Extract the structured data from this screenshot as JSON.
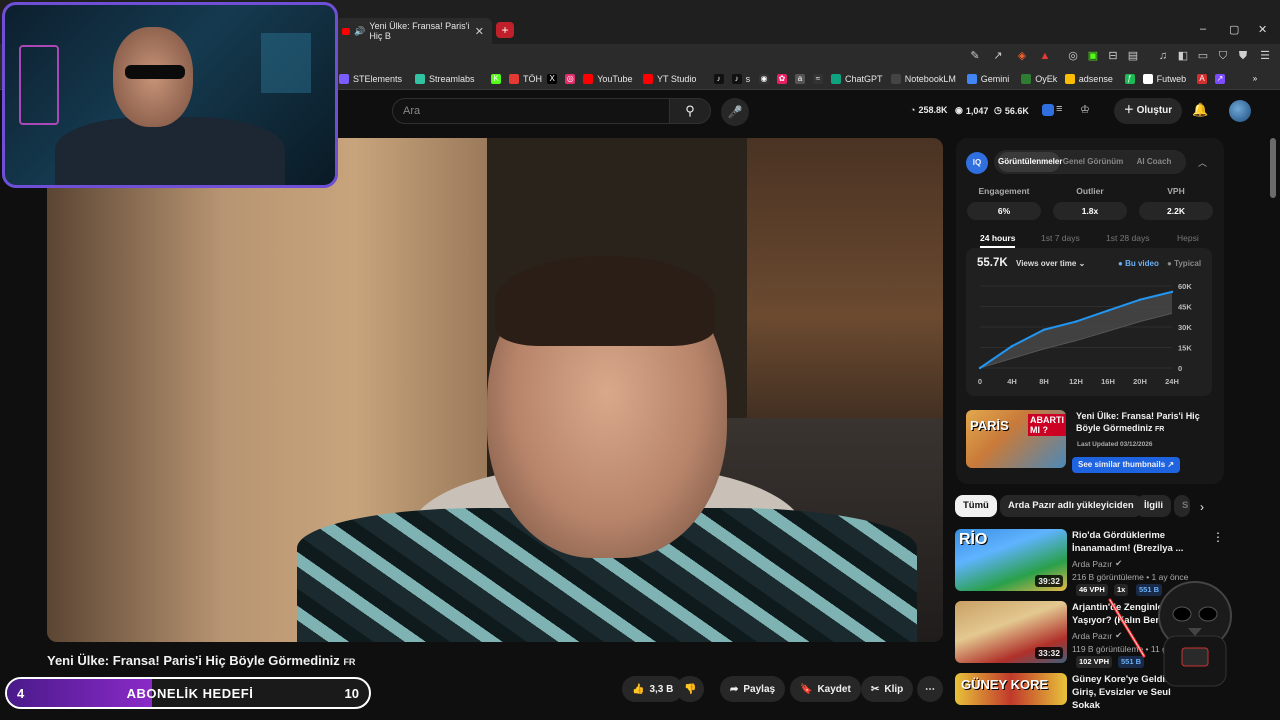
{
  "browser": {
    "tab_title": "Yeni Ülke: Fransa! Paris'i Hiç B",
    "new_tab": "+",
    "window_controls": [
      "–",
      "▢",
      "✕"
    ],
    "bookmarks": [
      {
        "label": "STElements",
        "color": "#7a5cff"
      },
      {
        "label": "Streamlabs",
        "color": "#31c3a2"
      },
      {
        "label": "",
        "color": "#53fc18",
        "glyph": "K"
      },
      {
        "label": "TÖH",
        "color": "#e53935"
      },
      {
        "label": "",
        "color": "#000000",
        "glyph": "X"
      },
      {
        "label": "",
        "color": "#e1306c",
        "glyph": "◎"
      },
      {
        "label": "YouTube",
        "color": "#ff0000"
      },
      {
        "label": "YT Studio",
        "color": "#ff0000"
      },
      {
        "label": "",
        "color": "#111111",
        "glyph": "♪"
      },
      {
        "label": "s",
        "color": "#111111",
        "glyph": "♪"
      },
      {
        "label": "",
        "color": "#333333",
        "glyph": "◉"
      },
      {
        "label": "",
        "color": "#e91e63",
        "glyph": "✿"
      },
      {
        "label": "",
        "color": "#555555",
        "glyph": "a"
      },
      {
        "label": "",
        "color": "#333333",
        "glyph": "≈"
      },
      {
        "label": "ChatGPT",
        "color": "#10a37f"
      },
      {
        "label": "NotebookLM",
        "color": "#444444"
      },
      {
        "label": "Gemini",
        "color": "#4285f4"
      },
      {
        "label": "OyEk",
        "color": "#2e7d32"
      },
      {
        "label": "adsense",
        "color": "#fbbc04"
      },
      {
        "label": "",
        "color": "#1db954",
        "glyph": "ƒ"
      },
      {
        "label": "Futweb",
        "color": "#ffffff"
      },
      {
        "label": "",
        "color": "#d32f2f",
        "glyph": "A"
      },
      {
        "label": "",
        "color": "#7c4dff",
        "glyph": "↗"
      },
      {
        "label": "",
        "color": "#2b2b2b",
        "glyph": "»"
      }
    ]
  },
  "header": {
    "search_placeholder": "Ara",
    "stats": {
      "subs": "258.8K",
      "videos": "1,047",
      "views": "56.6K"
    },
    "create_label": "Oluştur"
  },
  "video": {
    "title": "Yeni Ülke: Fransa! Paris'i Hiç Böyle Görmediniz",
    "lang_tag": "FR",
    "actions": {
      "likes": "3,3 B",
      "share": "Paylaş",
      "save": "Kaydet",
      "clip": "Klip",
      "more": "⋯"
    }
  },
  "overlay": {
    "sub_goal": {
      "current": "4",
      "label": "ABONELİK HEDEFİ",
      "target": "10",
      "progress": 0.4
    }
  },
  "vidiq": {
    "logo": "IQ",
    "tabs": [
      "Görüntülenmeler",
      "Genel Görünüm",
      "AI Coach"
    ],
    "metrics": [
      {
        "label": "Engagement",
        "value": "6%"
      },
      {
        "label": "Outlier",
        "value": "1.8x"
      },
      {
        "label": "VPH",
        "value": "2.2K"
      }
    ],
    "periods": [
      "24 hours",
      "1st 7 days",
      "1st 28 days",
      "Hepsi"
    ],
    "total": "55.7K",
    "views_dropdown": "Views over time",
    "legend": [
      "Bu video",
      "Typical"
    ],
    "video_title": "Yeni Ülke: Fransa! Paris'i Hiç Böyle Görmediniz",
    "video_lang": "FR",
    "last_updated": "Last Updated 03/12/2026",
    "similar_btn": "See similar thumbnails",
    "thumb_text": "PARİS",
    "thumb_badge": "ABARTI MI ?"
  },
  "chart_data": {
    "type": "area",
    "x": [
      "0",
      "4H",
      "8H",
      "12H",
      "16H",
      "20H",
      "24H"
    ],
    "series": [
      {
        "name": "Bu video",
        "values": [
          0,
          16000,
          28000,
          34000,
          42000,
          50000,
          55700
        ]
      },
      {
        "name": "Typical",
        "values": [
          0,
          7000,
          14000,
          20000,
          27000,
          34000,
          40000
        ]
      }
    ],
    "yticks": [
      "0",
      "15K",
      "30K",
      "45K",
      "60K"
    ],
    "ylim": [
      0,
      60000
    ],
    "colors": {
      "video": "#2196f3",
      "typical": "#555555"
    }
  },
  "chips": [
    "Tümü",
    "Arda Pazır adlı yükleyiciden",
    "İlgili",
    "S"
  ],
  "recommendations": [
    {
      "title": "Rio'da Gördüklerime İnanamadım! (Brezilya ...",
      "channel": "Arda Pazır",
      "meta": "216 B görüntüleme • 1 ay önce",
      "duration": "39:32",
      "vph": "46 VPH",
      "mult": "1x",
      "extra": "551 B",
      "thumb_text": "RİO"
    },
    {
      "title": "Arjantin'de Zenginler Nasıl Yaşıyor? (Kalın Berb...",
      "channel": "Arda Pazır",
      "meta": "119 B görüntüleme • 11 g",
      "duration": "33:32",
      "vph": "102 VPH",
      "mult": "",
      "extra": "551 B",
      "thumb_text": ""
    },
    {
      "title": "Güney Kore'ye Geldim! Giriş, Evsizler ve Seul Sokak",
      "channel": "",
      "meta": "",
      "duration": "",
      "vph": "",
      "mult": "",
      "extra": "",
      "thumb_text": "GÜNEY KORE"
    }
  ]
}
